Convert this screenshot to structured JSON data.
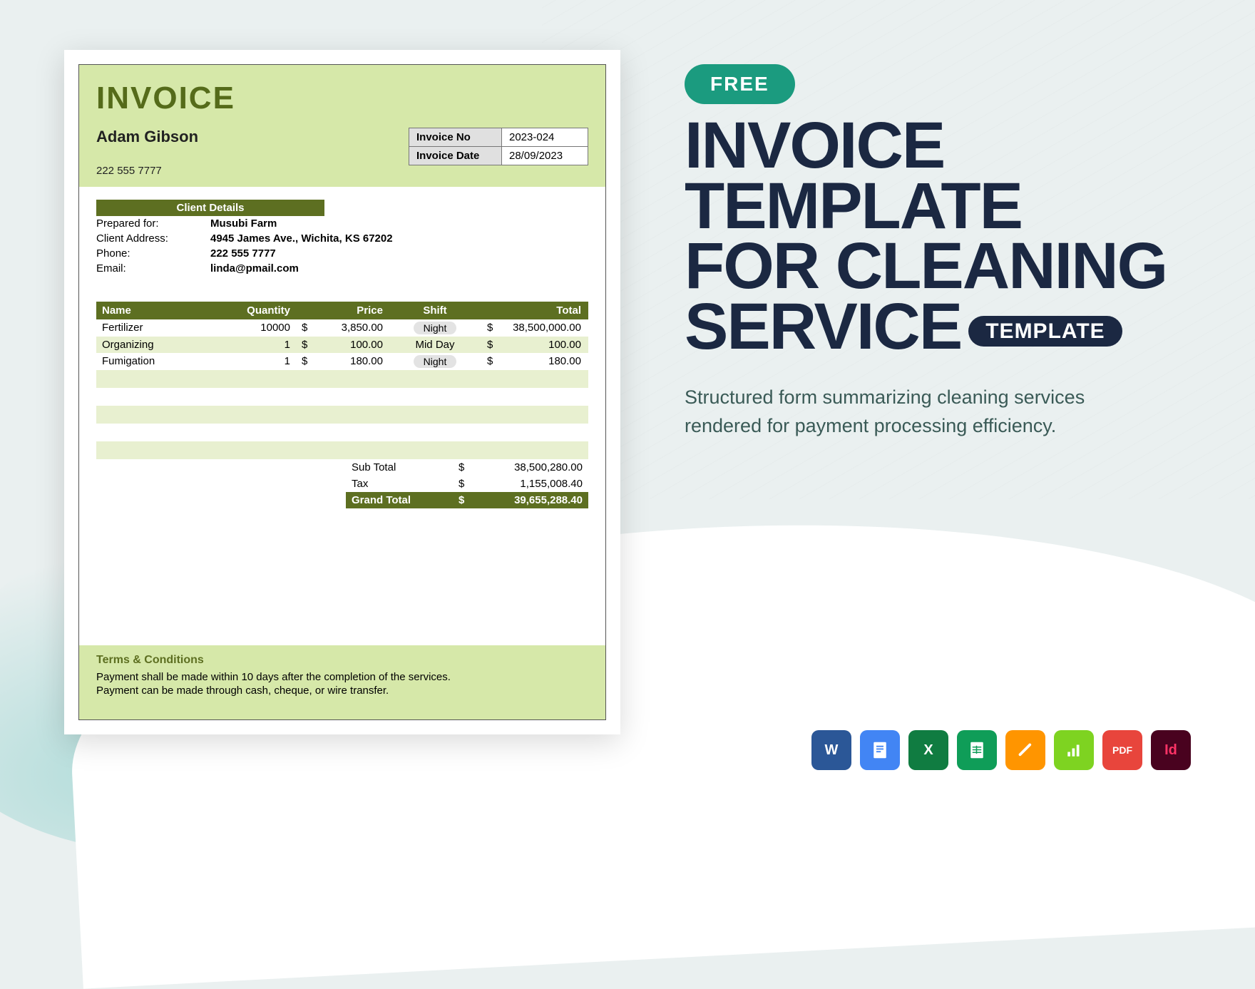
{
  "invoice": {
    "title": "INVOICE",
    "name": "Adam Gibson",
    "phone": "222 555 7777",
    "meta": {
      "no_lbl": "Invoice No",
      "no_val": "2023-024",
      "date_lbl": "Invoice Date",
      "date_val": "28/09/2023"
    },
    "client": {
      "header": "Client Details",
      "rows": [
        {
          "lbl": "Prepared for:",
          "val": "Musubi Farm"
        },
        {
          "lbl": "Client Address:",
          "val": "4945 James Ave., Wichita, KS 67202"
        },
        {
          "lbl": "Phone:",
          "val": "222 555 7777"
        },
        {
          "lbl": "Email:",
          "val": "linda@pmail.com"
        }
      ]
    },
    "items": {
      "headers": {
        "name": "Name",
        "qty": "Quantity",
        "price": "Price",
        "shift": "Shift",
        "total": "Total"
      },
      "rows": [
        {
          "name": "Fertilizer",
          "qty": "10000",
          "cur": "$",
          "price": "3,850.00",
          "shift": "Night",
          "tcur": "$",
          "total": "38,500,000.00"
        },
        {
          "name": "Organizing",
          "qty": "1",
          "cur": "$",
          "price": "100.00",
          "shift": "Mid Day",
          "tcur": "$",
          "total": "100.00"
        },
        {
          "name": "Fumigation",
          "qty": "1",
          "cur": "$",
          "price": "180.00",
          "shift": "Night",
          "tcur": "$",
          "total": "180.00"
        }
      ]
    },
    "totals": {
      "sub_lbl": "Sub Total",
      "sub_cur": "$",
      "sub_val": "38,500,280.00",
      "tax_lbl": "Tax",
      "tax_cur": "$",
      "tax_val": "1,155,008.40",
      "grand_lbl": "Grand Total",
      "grand_cur": "$",
      "grand_val": "39,655,288.40"
    },
    "terms": {
      "header": "Terms & Conditions",
      "l1": "Payment shall be made within 10 days after the completion of the services.",
      "l2": "Payment can be made through cash, cheque, or wire transfer."
    }
  },
  "side": {
    "free": "FREE",
    "l1": "INVOICE",
    "l2": "TEMPLATE",
    "l3": "FOR CLEANING",
    "l4": "SERVICE",
    "template": "TEMPLATE",
    "desc": "Structured form summarizing cleaning services rendered for payment processing efficiency."
  },
  "apps": {
    "word": "W",
    "docs": "",
    "excel": "X",
    "sheets": "",
    "pages": "",
    "numbers": "",
    "pdf": "PDF",
    "indesign": "Id"
  }
}
